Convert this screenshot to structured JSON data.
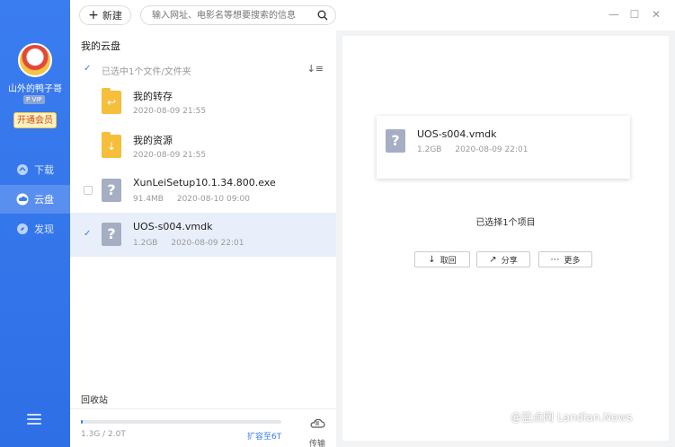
{
  "sidebar": {
    "username": "山外的鸭子哥",
    "vip_badge": "P VIP",
    "open_vip": "开通会员",
    "items": [
      {
        "label": "下载",
        "icon": "download-icon"
      },
      {
        "label": "云盘",
        "icon": "cloud-icon",
        "active": true
      },
      {
        "label": "发现",
        "icon": "discover-icon"
      }
    ],
    "menu_icon": "menu-icon"
  },
  "topbar": {
    "new_label": "新建",
    "search_placeholder": "输入网址、电影名等想要搜索的信息",
    "window_controls": [
      "minimize-icon",
      "maximize-icon",
      "close-icon"
    ]
  },
  "file_panel": {
    "title": "我的云盘",
    "selection_text": "已选中1个文件/文件夹",
    "files": [
      {
        "name": "我的转存",
        "size": "",
        "date": "2020-08-09 21:55",
        "type": "folder",
        "checked": false
      },
      {
        "name": "我的资源",
        "size": "",
        "date": "2020-08-09 21:55",
        "type": "folder",
        "checked": false
      },
      {
        "name": "XunLeiSetup10.1.34.800.exe",
        "size": "91.4MB",
        "date": "2020-08-10 09:00",
        "type": "unknown",
        "checked": false
      },
      {
        "name": "UOS-s004.vmdk",
        "size": "1.2GB",
        "date": "2020-08-09 22:01",
        "type": "unknown",
        "checked": true
      }
    ],
    "recycle_label": "回收站",
    "storage": {
      "usage_text": "1.3G / 2.0T",
      "used_fraction": 0.01,
      "expand_label": "扩容至6T",
      "transfer_label": "传输"
    }
  },
  "detail": {
    "file_name": "UOS-s004.vmdk",
    "file_size": "1.2GB",
    "file_date": "2020-08-09 22:01",
    "selected_count_text": "已选择1个项目",
    "actions": [
      {
        "label": "取回",
        "icon": "download-arrow-icon"
      },
      {
        "label": "分享",
        "icon": "share-icon"
      },
      {
        "label": "更多",
        "icon": "more-icon"
      }
    ]
  },
  "watermark": "@蓝点网 Landian.News",
  "colors": {
    "accent": "#3a7df0",
    "folder": "#f6be3a",
    "selected_row": "#e9effa"
  }
}
